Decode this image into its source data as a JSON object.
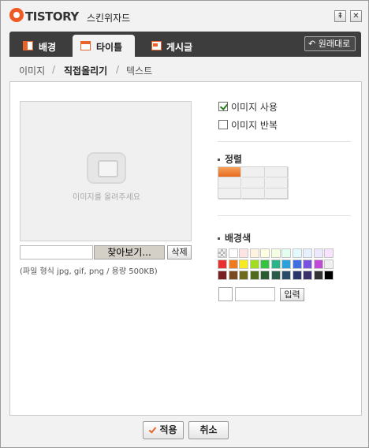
{
  "app": {
    "brand": "TISTORY",
    "title": "스킨위자드",
    "minimize_glyph": "⇞",
    "close_glyph": "✕"
  },
  "tabs": [
    {
      "label": "배경",
      "icon": "layout-left-icon",
      "active": false
    },
    {
      "label": "타이틀",
      "icon": "layout-top-icon",
      "active": true
    },
    {
      "label": "게시글",
      "icon": "post-icon",
      "active": false
    }
  ],
  "restore_button": {
    "glyph": "↶",
    "label": "원래대로"
  },
  "subtabs": {
    "items": [
      {
        "label": "이미지",
        "active": false
      },
      {
        "label": "직접올리기",
        "active": true
      },
      {
        "label": "텍스트",
        "active": false
      }
    ],
    "separator": "/"
  },
  "preview": {
    "placeholder": "이미지를 올려주세요"
  },
  "file": {
    "value": "",
    "browse_label": "찾아보기...",
    "delete_label": "삭제",
    "note": "(파일 형식 jpg, gif, png / 용량 500KB)"
  },
  "options": [
    {
      "label": "이미지 사용",
      "checked": true
    },
    {
      "label": "이미지 반복",
      "checked": false
    }
  ],
  "alignment": {
    "title": "정렬",
    "rows": 3,
    "cols": 3,
    "selected_row": 0,
    "selected_col": 0
  },
  "background": {
    "title": "배경색",
    "palette": [
      [
        "transparent",
        "#ffffff",
        "#fde3e3",
        "#fff3df",
        "#ffffe3",
        "#f3ffe0",
        "#e3ffef",
        "#e3fbff",
        "#e6f0ff",
        "#ece8ff",
        "#f7e3ff"
      ],
      [
        "#ea2f2f",
        "#f07a1e",
        "#f7ea20",
        "#9fdc22",
        "#33c33f",
        "#28b58a",
        "#2ba0d9",
        "#3f6fe0",
        "#7a52e0",
        "#c04ad6",
        "#f0f0f0"
      ],
      [
        "#7a2020",
        "#7a4a20",
        "#6e6a1f",
        "#4f6a1f",
        "#2a5a2f",
        "#2a5a4a",
        "#2a4a6a",
        "#2a356a",
        "#3a2f6a",
        "#333333",
        "#000000"
      ]
    ],
    "color_value": "",
    "input_label": "입력"
  },
  "footer": {
    "apply_label": "적용",
    "cancel_label": "취소"
  }
}
